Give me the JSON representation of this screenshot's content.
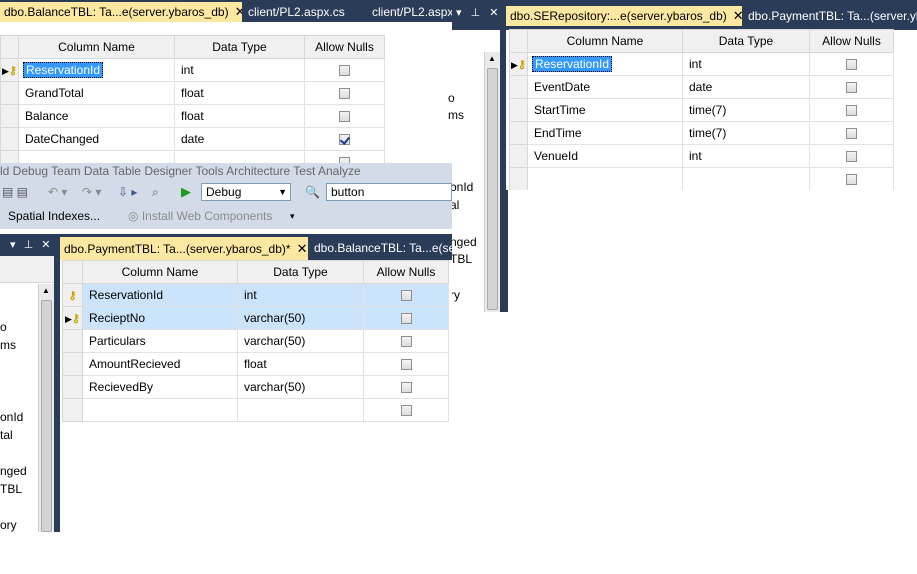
{
  "panel_balance": {
    "tabs": [
      {
        "label": "dbo.BalanceTBL: Ta...e(server.ybaros_db)",
        "active": true,
        "close": "✕"
      },
      {
        "label": "client/PL2.aspx.cs",
        "active": false
      },
      {
        "label": "client/PL2.aspx",
        "active": false
      }
    ],
    "headers": [
      "Column Name",
      "Data Type",
      "Allow Nulls"
    ],
    "rows": [
      {
        "name": "ReservationId",
        "type": "int",
        "nulls": false,
        "key": true
      },
      {
        "name": "GrandTotal",
        "type": "float",
        "nulls": false
      },
      {
        "name": "Balance",
        "type": "float",
        "nulls": false
      },
      {
        "name": "DateChanged",
        "type": "date",
        "nulls": true
      }
    ]
  },
  "panel_serepo": {
    "tabs": [
      {
        "label": "dbo.SERepository:...e(server.ybaros_db)",
        "active": true,
        "close": "✕"
      },
      {
        "label": "dbo.PaymentTBL: Ta...(server.yb",
        "active": false
      }
    ],
    "headers": [
      "Column Name",
      "Data Type",
      "Allow Nulls"
    ],
    "rows": [
      {
        "name": "ReservationId",
        "type": "int",
        "nulls": false,
        "key": true
      },
      {
        "name": "EventDate",
        "type": "date",
        "nulls": false
      },
      {
        "name": "StartTime",
        "type": "time(7)",
        "nulls": false
      },
      {
        "name": "EndTime",
        "type": "time(7)",
        "nulls": false
      },
      {
        "name": "VenueId",
        "type": "int",
        "nulls": false
      }
    ]
  },
  "panel_payment": {
    "tabs": [
      {
        "label": "dbo.PaymentTBL: Ta...(server.ybaros_db)*",
        "active": true,
        "close": "✕"
      },
      {
        "label": "dbo.BalanceTBL: Ta...e(ser",
        "active": false
      }
    ],
    "headers": [
      "Column Name",
      "Data Type",
      "Allow Nulls"
    ],
    "rows": [
      {
        "name": "ReservationId",
        "type": "int",
        "nulls": false,
        "key": true
      },
      {
        "name": "RecieptNo",
        "type": "varchar(50)",
        "nulls": false,
        "key": true
      },
      {
        "name": "Particulars",
        "type": "varchar(50)",
        "nulls": false
      },
      {
        "name": "AmountRecieved",
        "type": "float",
        "nulls": false
      },
      {
        "name": "RecievedBy",
        "type": "varchar(50)",
        "nulls": false
      }
    ]
  },
  "menu_fragment": "ld   Debug   Team   Data   Table Designer   Tools   Architecture   Test   Analyze",
  "toolbar": {
    "config_value": "Debug",
    "search_value": "button",
    "spatial_label": "Spatial Indexes...",
    "install_label": "Install Web Components"
  },
  "side_fragments_right": [
    "o",
    "ms",
    "onId",
    "al",
    "nged",
    "TBL",
    "ry"
  ],
  "side_fragments_left": [
    "o",
    "ms",
    "onId",
    "tal",
    "nged",
    "TBL",
    "ory"
  ],
  "window_buttons": {
    "pin": "⊥",
    "close": "✕",
    "dropdown": "▾"
  }
}
